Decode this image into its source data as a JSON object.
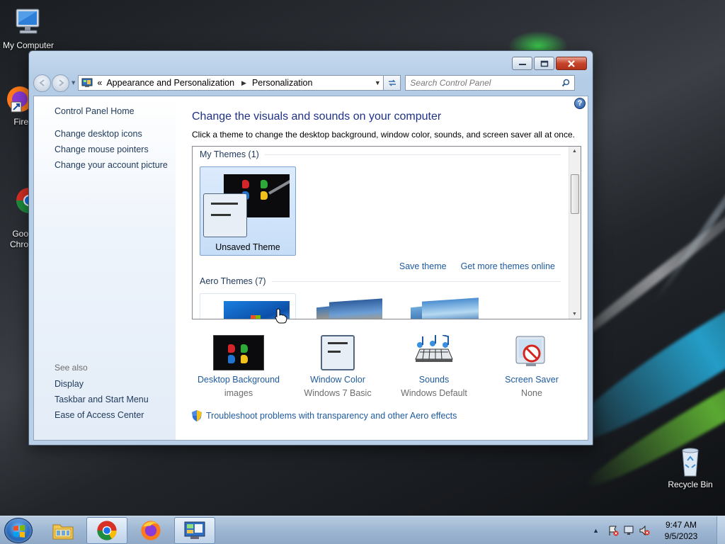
{
  "desktop": {
    "icons": [
      {
        "label": "My Computer"
      },
      {
        "label": "Fire"
      },
      {
        "label": "Goo\nChro"
      },
      {
        "label": "Recycle Bin"
      }
    ]
  },
  "window": {
    "address": {
      "overflow": "«",
      "segments": [
        "Appearance and Personalization",
        "Personalization"
      ]
    },
    "search_placeholder": "Search Control Panel",
    "left": {
      "home": "Control Panel Home",
      "links": [
        "Change desktop icons",
        "Change mouse pointers",
        "Change your account picture"
      ],
      "see_also_heading": "See also",
      "see_also": [
        "Display",
        "Taskbar and Start Menu",
        "Ease of Access Center"
      ]
    },
    "main": {
      "title": "Change the visuals and sounds on your computer",
      "subtitle": "Click a theme to change the desktop background, window color, sounds, and screen saver all at once.",
      "my_themes_header": "My Themes (1)",
      "my_theme_label": "Unsaved Theme",
      "save_theme": "Save theme",
      "get_more": "Get more themes online",
      "aero_header": "Aero Themes (7)"
    },
    "bottom": [
      {
        "title": "Desktop Background",
        "value": "images",
        "icon": "desktop-background-icon"
      },
      {
        "title": "Window Color",
        "value": "Windows 7 Basic",
        "icon": "window-color-icon"
      },
      {
        "title": "Sounds",
        "value": "Windows Default",
        "icon": "sounds-icon"
      },
      {
        "title": "Screen Saver",
        "value": "None",
        "icon": "screen-saver-icon"
      }
    ],
    "troubleshoot": "Troubleshoot problems with transparency and other Aero effects"
  },
  "taskbar": {
    "time": "9:47 AM",
    "date": "9/5/2023"
  }
}
